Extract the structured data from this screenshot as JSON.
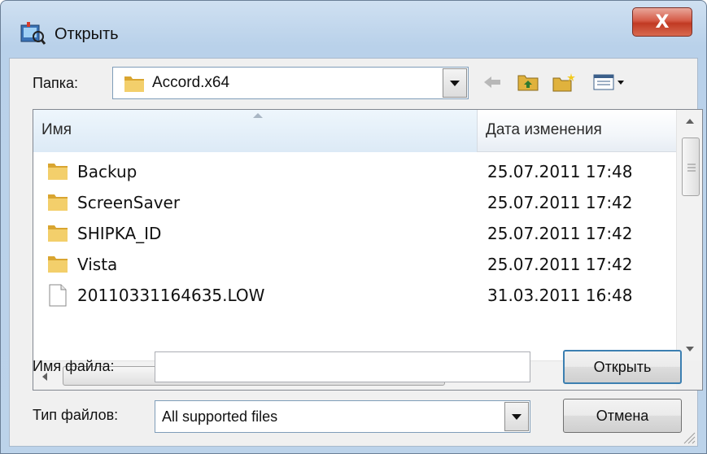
{
  "window": {
    "title": "Открыть",
    "close_label": "X"
  },
  "folder_bar": {
    "label": "Папка:",
    "current_folder": "Accord.x64"
  },
  "toolbar": {
    "icons": [
      "back-arrow-icon",
      "up-folder-icon",
      "new-folder-icon",
      "view-menu-icon"
    ]
  },
  "file_list": {
    "columns": [
      "Имя",
      "Дата изменения"
    ],
    "rows": [
      {
        "name": "Backup",
        "date": "25.07.2011 17:48",
        "type": "folder"
      },
      {
        "name": "ScreenSaver",
        "date": "25.07.2011 17:42",
        "type": "folder"
      },
      {
        "name": "SHIPKA_ID",
        "date": "25.07.2011 17:42",
        "type": "folder"
      },
      {
        "name": "Vista",
        "date": "25.07.2011 17:42",
        "type": "folder"
      },
      {
        "name": "20110331164635.LOW",
        "date": "31.03.2011 16:48",
        "type": "file"
      }
    ]
  },
  "filename": {
    "label": "Имя файла:",
    "value": ""
  },
  "filetype": {
    "label": "Тип файлов:",
    "value": "All supported files"
  },
  "buttons": {
    "open": "Открыть",
    "cancel": "Отмена"
  },
  "colors": {
    "folder": "#e8b84a",
    "close": "#c13a23",
    "accent": "#3c7fb1"
  }
}
